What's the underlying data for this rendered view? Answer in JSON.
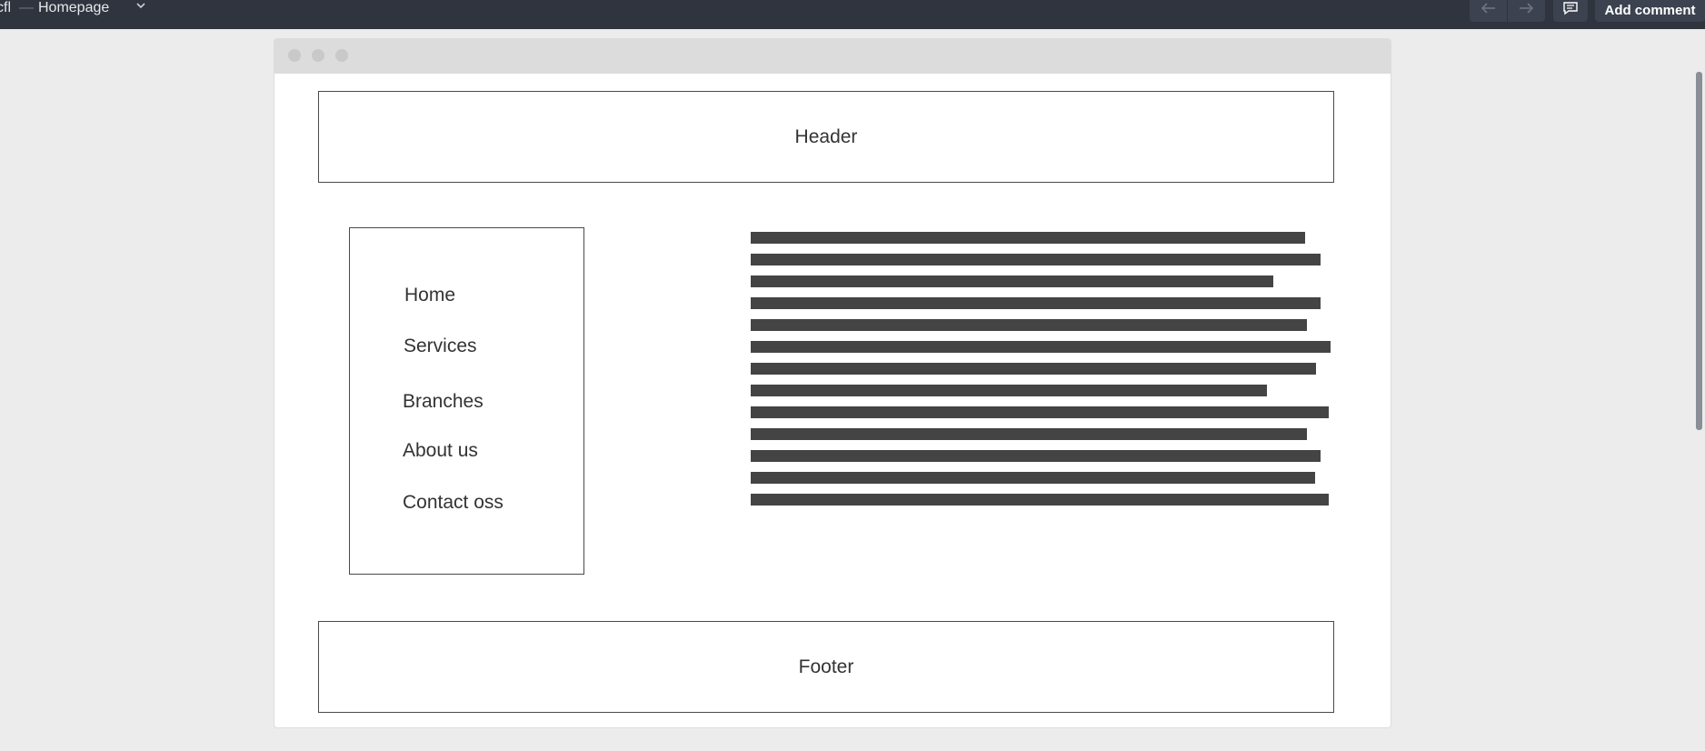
{
  "topbar": {
    "project_fragment": "cfl",
    "separator": "—",
    "page_name": "Homepage",
    "nav_back_icon": "arrow-left-icon",
    "nav_forward_icon": "arrow-right-icon",
    "comments_icon": "comment-icon",
    "add_comment_label": "Add comment",
    "colors": {
      "bar": "#2f343e",
      "button": "#3c4250"
    }
  },
  "wireframe": {
    "header_label": "Header",
    "footer_label": "Footer",
    "nav_items": [
      "Home",
      "Services",
      "Branches",
      "About us",
      "Contact oss"
    ],
    "text_placeholder_line_count": 13,
    "colors": {
      "stroke": "#4a4a4a",
      "text_bar": "#444444"
    }
  }
}
